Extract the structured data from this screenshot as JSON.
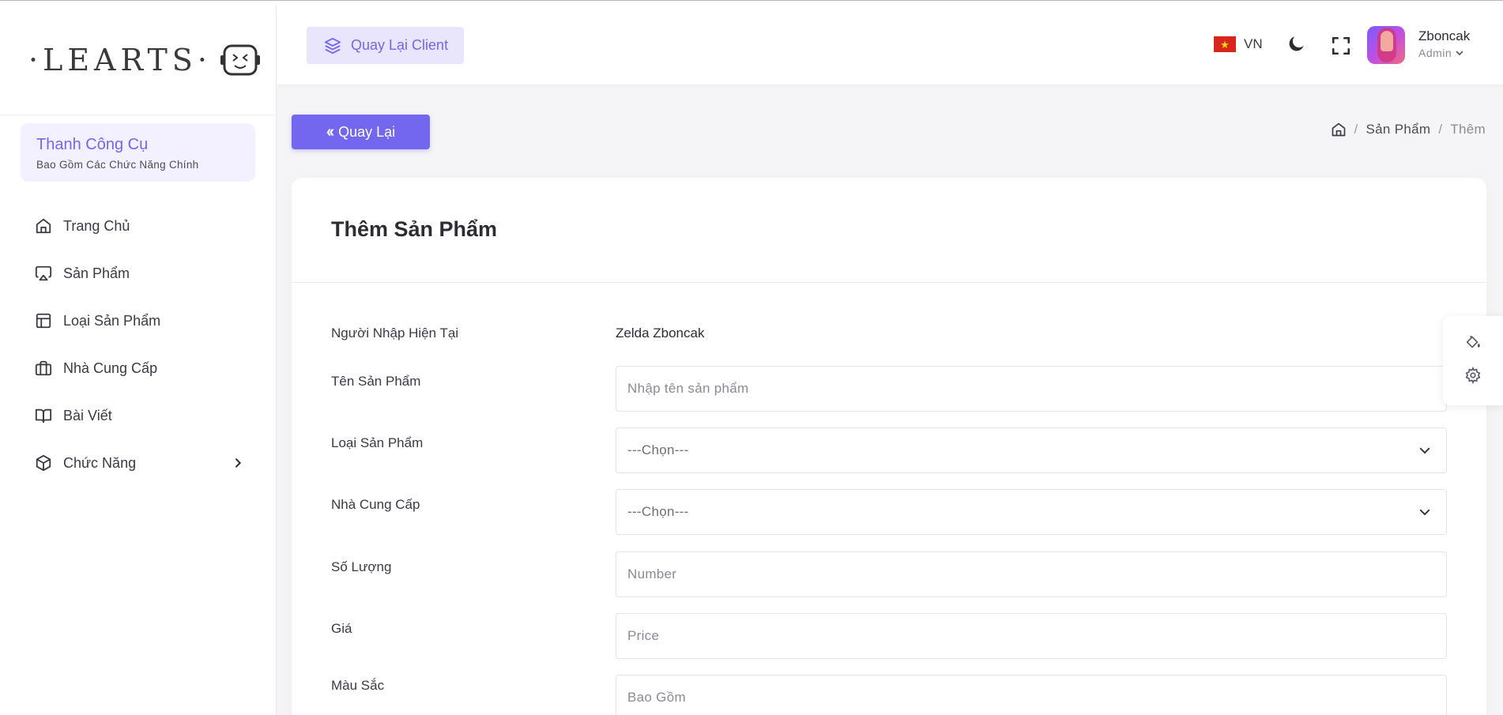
{
  "brand": {
    "logo_text": "·LEARTS·"
  },
  "sidebar": {
    "toolbox_title": "Thanh Công Cụ",
    "toolbox_subtitle": "Bao Gồm Các Chức Năng Chính",
    "items": [
      {
        "label": "Trang Chủ",
        "icon": "home-icon"
      },
      {
        "label": "Sản Phẩm",
        "icon": "airplay-icon"
      },
      {
        "label": "Loại Sản Phẩm",
        "icon": "layout-icon"
      },
      {
        "label": "Nhà Cung Cấp",
        "icon": "briefcase-icon"
      },
      {
        "label": "Bài Viết",
        "icon": "book-icon"
      },
      {
        "label": "Chức Năng",
        "icon": "box-icon"
      }
    ]
  },
  "header": {
    "client_button": "Quay Lại Client",
    "language": "VN",
    "user_name": "Zboncak",
    "user_role": "Admin"
  },
  "toolbar": {
    "back_label": "Quay Lại"
  },
  "breadcrumb": {
    "items": [
      "Sản Phẩm",
      "Thêm"
    ]
  },
  "form": {
    "title": "Thêm Sản Phẩm",
    "current_user_label": "Người Nhập Hiện Tại",
    "current_user_value": "Zelda Zboncak",
    "fields": [
      {
        "label": "Tên Sản Phẩm",
        "placeholder": "Nhập tên sản phẩm",
        "type": "text"
      },
      {
        "label": "Loại Sản Phẩm",
        "value": "---Chọn---",
        "type": "select"
      },
      {
        "label": "Nhà Cung Cấp",
        "value": "---Chọn---",
        "type": "select"
      },
      {
        "label": "Số Lượng",
        "placeholder": "Number",
        "type": "text"
      },
      {
        "label": "Giá",
        "placeholder": "Price",
        "type": "text"
      },
      {
        "label": "Màu Sắc",
        "placeholder": "Bao Gồm",
        "type": "text"
      }
    ]
  },
  "colors": {
    "accent": "#7367f0",
    "accent_light": "#e8e5fd",
    "background": "#f5f5f7"
  }
}
